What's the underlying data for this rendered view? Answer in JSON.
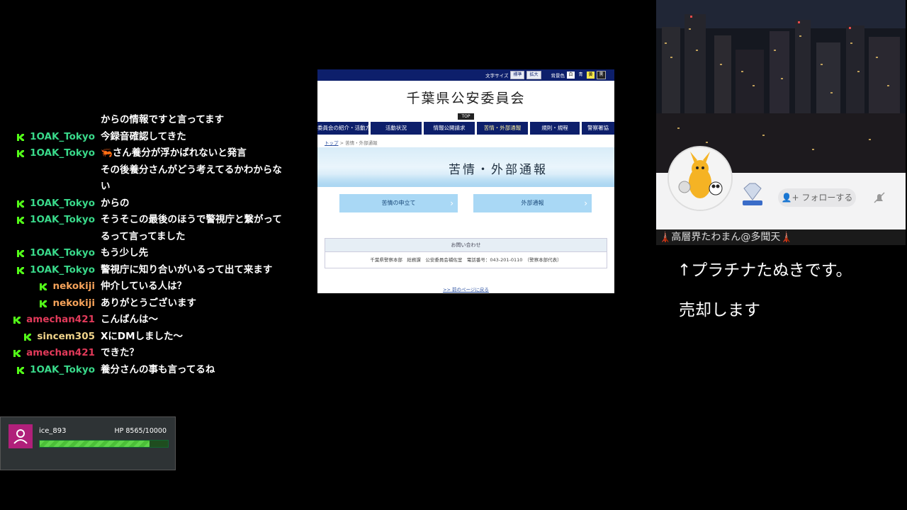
{
  "chat": {
    "messages": [
      {
        "user": "",
        "user_color": "",
        "text": "からの情報ですと言ってます",
        "lines": 1
      },
      {
        "user": "1OAK_Tokyo",
        "user_color": "#39d98a",
        "text": "今録音確認してきた",
        "lines": 1
      },
      {
        "user": "1OAK_Tokyo",
        "user_color": "#39d98a",
        "text": "🦐さん養分が浮かばれないと発言",
        "lines": 1
      },
      {
        "user": "",
        "user_color": "",
        "text": "その後養分さんがどう考えてるかわからない",
        "lines": 2
      },
      {
        "user": "1OAK_Tokyo",
        "user_color": "#39d98a",
        "text": "からの",
        "lines": 1
      },
      {
        "user": "1OAK_Tokyo",
        "user_color": "#39d98a",
        "text": "そうそこの最後のほうで警視庁と繋がってるって言ってました",
        "lines": 2
      },
      {
        "user": "1OAK_Tokyo",
        "user_color": "#39d98a",
        "text": "もう少し先",
        "lines": 1
      },
      {
        "user": "1OAK_Tokyo",
        "user_color": "#39d98a",
        "text": "警視庁に知り合いがいるって出て来ます",
        "lines": 2
      },
      {
        "user": "nekokiji",
        "user_color": "#f5a25a",
        "text": "仲介している人は？",
        "lines": 1
      },
      {
        "user": "nekokiji",
        "user_color": "#f5a25a",
        "text": "ありがとうございます",
        "lines": 1
      },
      {
        "user": "amechan421",
        "user_color": "#e23a5a",
        "text": "こんばんは〜",
        "lines": 1
      },
      {
        "user": "sincem305",
        "user_color": "#f0d48a",
        "text": "XにDMしました〜",
        "lines": 1
      },
      {
        "user": "amechan421",
        "user_color": "#e23a5a",
        "text": "できた？",
        "lines": 1
      },
      {
        "user": "1OAK_Tokyo",
        "user_color": "#39d98a",
        "text": "養分さんの事も言ってるね",
        "lines": 1
      }
    ],
    "kick_icon_color": "#53fc18"
  },
  "site": {
    "font_size_label": "文字サイズ",
    "size_standard": "標準",
    "size_large": "拡大",
    "bg_color_label": "背景色",
    "bg_white": "白",
    "bg_blue": "青",
    "bg_yellow": "黄",
    "bg_black": "黒",
    "title": "千葉県公安委員会",
    "top_label": "TOP",
    "nav": [
      "委員会の紹介・活動方針",
      "活動状況",
      "情報公開請求",
      "苦情・外部通報",
      "規則・規程",
      "警察署協"
    ],
    "nav_active_index": 3,
    "breadcrumb_top": "トップ",
    "breadcrumb_sep": ">",
    "breadcrumb_current": "苦情・外部通報",
    "heading": "苦情・外部通報",
    "button_left": "苦情の申立て",
    "button_right": "外部通報",
    "contact_header": "お問い合わせ",
    "contact_body": "千葉県警察本部　総務課　公安委員会補佐室　電話番号：043-201-0110　（警察本部代表）",
    "back_link": ">> 前のページに戻る"
  },
  "panel": {
    "streamer_name": "🗼高層界たわまん@多聞天🗼",
    "follow_label": "フォローする",
    "badge_label": "プラチナ"
  },
  "notes": {
    "line1": "↑プラチナたぬきです。",
    "line2": "売却します"
  },
  "hp_widget": {
    "username": "ice_893",
    "hp_text": "HP 8565/10000",
    "hp_fraction": 0.8565
  }
}
